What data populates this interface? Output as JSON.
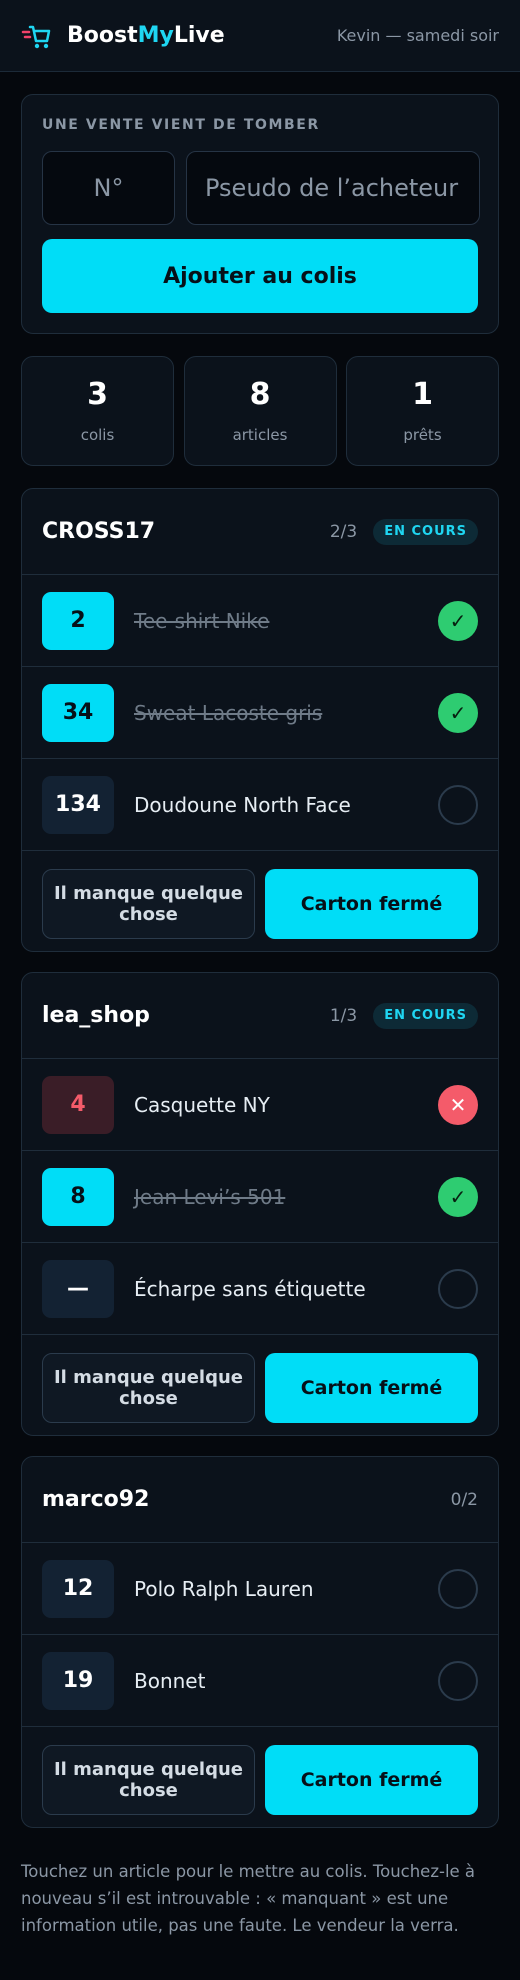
{
  "header": {
    "brand_part1": "Boost",
    "brand_part2": "My",
    "brand_part3": "Live",
    "user": "Kevin — samedi soir",
    "logo_icon": "shopping-cart-icon"
  },
  "sale": {
    "title": "UNE VENTE VIENT DE TOMBER",
    "number_placeholder": "N°",
    "pseudo_placeholder": "Pseudo de l’acheteur",
    "add_button": "Ajouter au colis"
  },
  "stats": [
    {
      "value": "3",
      "label": "colis"
    },
    {
      "value": "8",
      "label": "articles"
    },
    {
      "value": "1",
      "label": "prêts"
    }
  ],
  "orders": [
    {
      "name": "CROSS17",
      "count": "2/3",
      "badge": "EN COURS",
      "items": [
        {
          "number": "2",
          "label": "Tee-shirt Nike",
          "state": "picked",
          "status_icon": "check-icon",
          "status_glyph": "✓"
        },
        {
          "number": "34",
          "label": "Sweat Lacoste gris",
          "state": "picked",
          "status_icon": "check-icon",
          "status_glyph": "✓"
        },
        {
          "number": "134",
          "label": "Doudoune North Face",
          "state": "pending",
          "status_icon": "empty-circle-icon",
          "status_glyph": ""
        }
      ],
      "missing_button": "Il manque quelque chose",
      "closed_button": "Carton fermé"
    },
    {
      "name": "lea_shop",
      "count": "1/3",
      "badge": "EN COURS",
      "items": [
        {
          "number": "4",
          "label": "Casquette NY",
          "state": "missing",
          "status_icon": "cross-icon",
          "status_glyph": "✕"
        },
        {
          "number": "8",
          "label": "Jean Levi’s 501",
          "state": "picked",
          "status_icon": "check-icon",
          "status_glyph": "✓"
        },
        {
          "number": "—",
          "label": "Écharpe sans étiquette",
          "state": "pending",
          "status_icon": "empty-circle-icon",
          "status_glyph": ""
        }
      ],
      "missing_button": "Il manque quelque chose",
      "closed_button": "Carton fermé"
    },
    {
      "name": "marco92",
      "count": "0/2",
      "badge": "",
      "items": [
        {
          "number": "12",
          "label": "Polo Ralph Lauren",
          "state": "pending",
          "status_icon": "empty-circle-icon",
          "status_glyph": ""
        },
        {
          "number": "19",
          "label": "Bonnet",
          "state": "pending",
          "status_icon": "empty-circle-icon",
          "status_glyph": ""
        }
      ],
      "missing_button": "Il manque quelque chose",
      "closed_button": "Carton fermé"
    }
  ],
  "footer": "Touchez un article pour le mettre au colis. Touchez-le à nouveau s’il est introuvable : « manquant » est une information utile, pas une faute. Le vendeur la verra.",
  "colors": {
    "accent": "#00ddf7",
    "success": "#2ecc71",
    "danger": "#f45b6a",
    "background": "#05080d",
    "card": "#0b121b"
  }
}
